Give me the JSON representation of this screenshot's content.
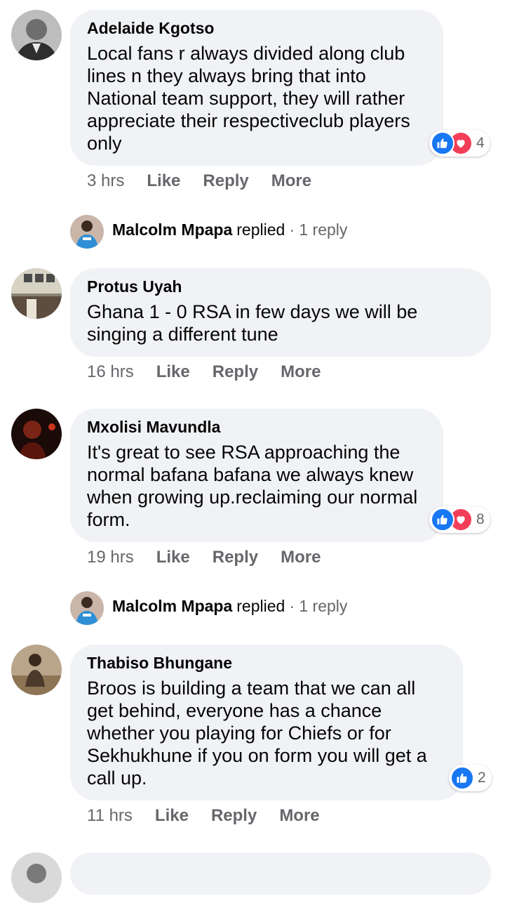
{
  "comments": [
    {
      "author": "Adelaide Kgotso",
      "text": "Local fans r always divided along club lines n they always bring that into National team support, they will rather appreciate their respectiveclub players only",
      "time": "3 hrs",
      "reaction_count": "4",
      "reactions": [
        "like-icon",
        "love-icon"
      ]
    },
    {
      "author": "Protus Uyah",
      "text": "Ghana 1 - 0 RSA in few days we will be singing a different tune",
      "time": "16 hrs"
    },
    {
      "author": "Mxolisi Mavundla",
      "text": "It's great to see RSA approaching the normal bafana bafana we always knew when growing up.reclaiming our normal form.",
      "time": "19 hrs",
      "reaction_count": "8",
      "reactions": [
        "like-icon",
        "love-icon"
      ]
    },
    {
      "author": "Thabiso Bhungane",
      "text": "Broos is building a team that we can all get behind, everyone has a chance whether you playing for Chiefs or for Sekhukhune if you on form you will get a call up.",
      "time": "11 hrs",
      "reaction_count": "2",
      "reactions": [
        "like-icon"
      ]
    }
  ],
  "replies": [
    {
      "name": "Malcolm Mpapa",
      "verb": "replied",
      "count": "· 1 reply"
    },
    {
      "name": "Malcolm Mpapa",
      "verb": "replied",
      "count": "· 1 reply"
    }
  ],
  "actions": {
    "like": "Like",
    "reply": "Reply",
    "more": "More"
  },
  "colors": {
    "bubble": "#f0f2f5",
    "like_blue": "#1877f2",
    "love_red": "#f33e58",
    "meta_gray": "#65676b"
  }
}
